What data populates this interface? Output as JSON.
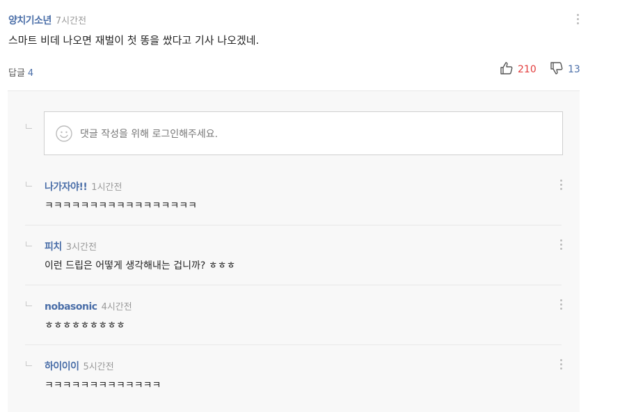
{
  "comment": {
    "author": "양치기소년",
    "time": "7시간전",
    "text": "스마트 비데 나오면 재벌이 첫 똥을 쌌다고 기사 나오겠네.",
    "reply_label": "답글",
    "reply_count": "4",
    "likes": "210",
    "dislikes": "13"
  },
  "login_prompt": "댓글 작성을 위해 로그인해주세요.",
  "replies": [
    {
      "author": "나가자야!!",
      "time": "1시간전",
      "text": "ㅋㅋㅋㅋㅋㅋㅋㅋㅋㅋㅋㅋㅋㅋㅋㅋㅋ"
    },
    {
      "author": "피치",
      "time": "3시간전",
      "text": "이런 드립은 어떻게 생각해내는 겁니까? ㅎㅎㅎ"
    },
    {
      "author": "nobasonic",
      "time": "4시간전",
      "text": "ㅎㅎㅎㅎㅎㅎㅎㅎㅎ"
    },
    {
      "author": "하이이이",
      "time": "5시간전",
      "text": "ㅋㅋㅋㅋㅋㅋㅋㅋㅋㅋㅋㅋㅋ"
    }
  ],
  "colors": {
    "author": "#4a6ea8",
    "like": "#e23b3b",
    "dislike": "#4a6ea8",
    "reply_bg": "#f8f8f8"
  }
}
